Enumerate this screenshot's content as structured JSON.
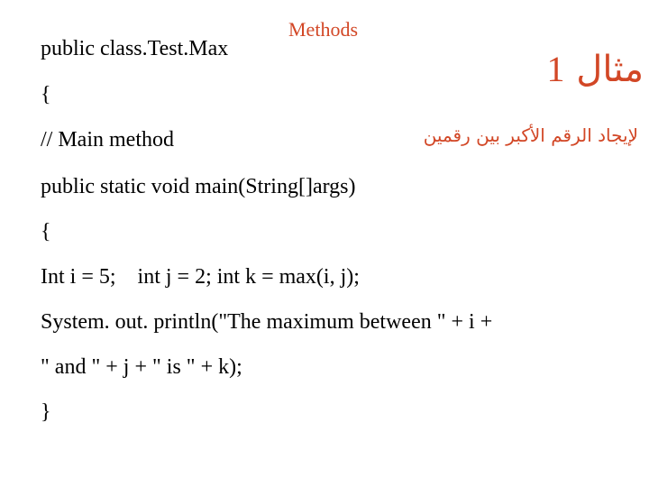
{
  "slide": {
    "heading": "Methods",
    "title": {
      "text": "مثال",
      "number": "1"
    },
    "subtitle": "لإيجاد الرقم الأكبر بين رقمين",
    "accent_color": "#D24726",
    "code_lines": [
      "public class.Test.Max",
      "{",
      "// Main method",
      "public static void main(String[]args)",
      "{",
      "Int i = 5;    int j = 2; int k = max(i, j);",
      "System. out. println(\"The maximum between \" + i +",
      "\" and \" + j + \" is \" + k);",
      "}"
    ]
  }
}
